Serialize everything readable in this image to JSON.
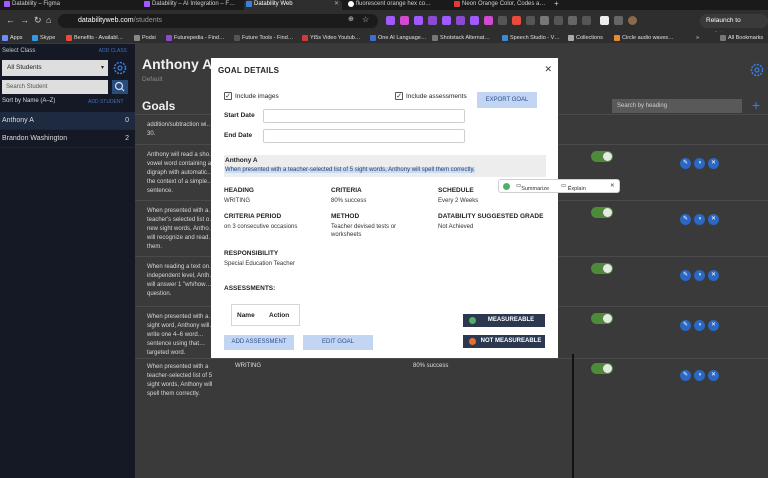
{
  "browser": {
    "tabs": [
      {
        "label": "Datability – Figma",
        "color": "#a259ff"
      },
      {
        "label": "Datability – AI Integration – F…",
        "color": "#a259ff"
      },
      {
        "label": "Datability Web",
        "color": "#3b7de0",
        "active": true
      },
      {
        "label": "fluorescent orange hex co…",
        "color": "#ffffff"
      },
      {
        "label": "Neon Orange Color, Codes a…",
        "color": "#e03b3b"
      }
    ],
    "url_domain": "databilityweb.com",
    "url_path": "/students",
    "relaunch_label": "Relaunch to update",
    "bookmarks": [
      {
        "label": "Apps",
        "color": "#6b8cff"
      },
      {
        "label": "Skype",
        "color": "#2f9be8"
      },
      {
        "label": "Benefits - Availabl…",
        "color": "#e84b3a"
      },
      {
        "label": "Podsi",
        "color": "#888888"
      },
      {
        "label": "Futurepedia - Find…",
        "color": "#8a4ad1"
      },
      {
        "label": "Future Tools - Find…",
        "color": "#555555"
      },
      {
        "label": "Yt5s Video Youtub…",
        "color": "#d13a3a"
      },
      {
        "label": "One AI Language…",
        "color": "#3a6fd1"
      },
      {
        "label": "Shotstack Alternat…",
        "color": "#777777"
      },
      {
        "label": "Speech Studio - V…",
        "color": "#3a8cd1"
      },
      {
        "label": "Collections",
        "color": "#aaaaaa"
      },
      {
        "label": "Circle audio waves…",
        "color": "#e88a2f"
      }
    ],
    "all_bookmarks": "All Bookmarks"
  },
  "sidebar": {
    "select_class_label": "Select Class",
    "add_class": "ADD CLASS",
    "class_value": "All Students",
    "search_placeholder": "Search Student",
    "sort_label": "Sort by Name (A–Z)",
    "add_student": "ADD STUDENT",
    "students": [
      {
        "name": "Anthony A",
        "count": "0"
      },
      {
        "name": "Brandon Washington",
        "count": "2"
      }
    ]
  },
  "main": {
    "student_name": "Anthony A",
    "student_sub": "Default",
    "goals_heading": "Goals",
    "search_placeholder": "Search by heading",
    "rows": [
      {
        "text": "addition/subtraction wi… 30."
      },
      {
        "text": "Anthony will read a sho… vowel word containing a… digraph with automatic… the context of a simple… sentence."
      },
      {
        "text": "When presented with a… teacher's selected list o… new sight words, Antho… will recognize and read… them."
      },
      {
        "text": "When reading a text on… independent level, Anth… will answer 1 \"wh/how… question."
      },
      {
        "text": "When presented with a… sight word, Anthony will… write one 4–6 word… sentence using that… targeted word."
      },
      {
        "text": "When presented with a teacher-selected list of 5 sight words, Anthony will spell them correctly."
      }
    ],
    "last_row_heading": "WRITING",
    "last_row_criteria": "80% success"
  },
  "modal": {
    "title": "GOAL DETAILS",
    "include_images": "Include images",
    "include_assessments": "Include assessments",
    "export_goal": "EXPORT GOAL",
    "start_date_label": "Start Date",
    "end_date_label": "End Date",
    "goal_student": "Anthony A",
    "goal_text": "When presented with a teacher-selected list of 5 sight words, Anthony will spell them correctly.",
    "heading_k": "HEADING",
    "heading_v": "WRITING",
    "criteria_k": "CRITERIA",
    "criteria_v": "80% success",
    "schedule_k": "SCHEDULE",
    "schedule_v": "Every 2 Weeks",
    "criteria_period_k": "CRITERIA PERIOD",
    "criteria_period_v": "on 3 consecutive occasions",
    "method_k": "METHOD",
    "method_v": "Teacher devised tests or worksheets",
    "suggested_k": "DATABILITY SUGGESTED GRADE",
    "suggested_v": "Not Achieved",
    "responsibility_k": "RESPONSIBILITY",
    "responsibility_v": "Special Education Teacher",
    "assessments_h": "ASSESSMENTS:",
    "col_name": "Name",
    "col_action": "Action",
    "add_assessment": "ADD ASSESSMENT",
    "edit_goal": "EDIT GOAL",
    "measurable": "MEASUREABLE",
    "not_measurable": "NOT MEASUREABLE",
    "measurable_color": "#4fb06a",
    "not_measurable_color": "#e8702a"
  },
  "ai_popup": {
    "summarize": "Summarize",
    "explain": "Explain"
  }
}
